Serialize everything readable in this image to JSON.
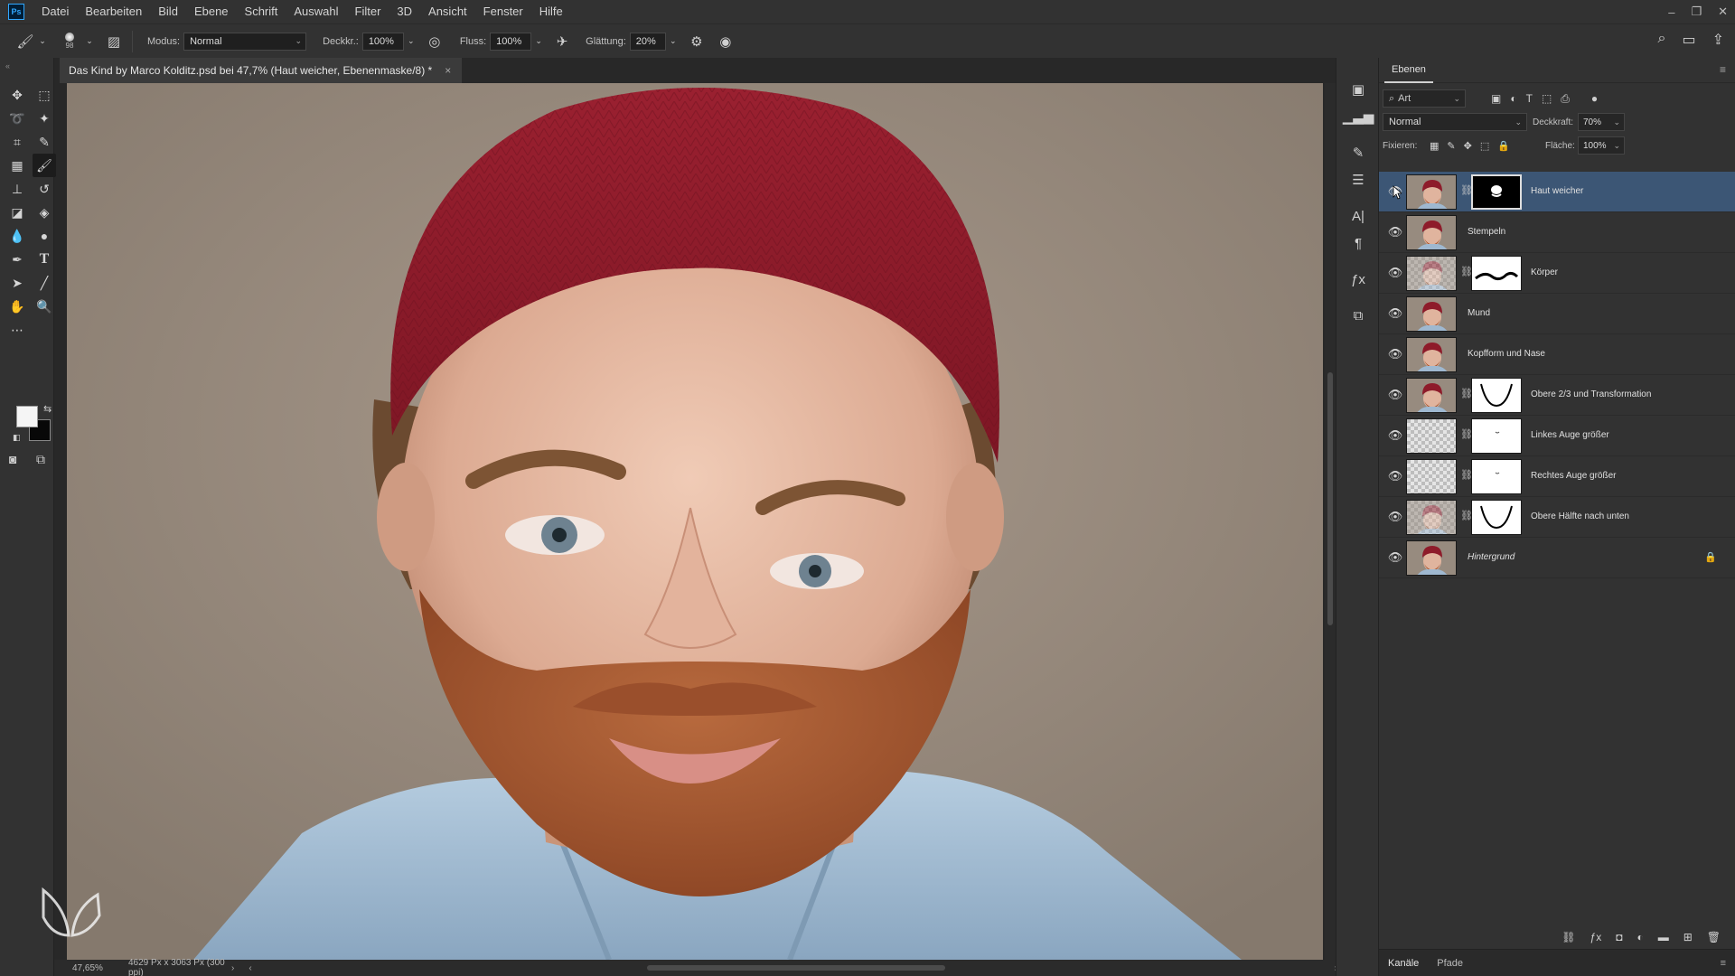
{
  "app": {
    "logo": "Ps"
  },
  "menu": [
    "Datei",
    "Bearbeiten",
    "Bild",
    "Ebene",
    "Schrift",
    "Auswahl",
    "Filter",
    "3D",
    "Ansicht",
    "Fenster",
    "Hilfe"
  ],
  "options": {
    "brush_size": "98",
    "mode_label": "Modus:",
    "mode_value": "Normal",
    "opacity_label": "Deckkr.:",
    "opacity_value": "100%",
    "flow_label": "Fluss:",
    "flow_value": "100%",
    "smoothing_label": "Glättung:",
    "smoothing_value": "20%"
  },
  "document": {
    "tab_title": "Das Kind by Marco Kolditz.psd bei 47,7% (Haut weicher, Ebenenmaske/8) *",
    "close_glyph": "×"
  },
  "status": {
    "zoom": "47,65%",
    "dimensions": "4629 Px x 3063 Px (300 ppi)"
  },
  "layers_panel": {
    "tab": "Ebenen",
    "filter_kind": "Art",
    "blend_mode": "Normal",
    "opacity_label": "Deckkraft:",
    "opacity_value": "70%",
    "lock_label": "Fixieren:",
    "fill_label": "Fläche:",
    "fill_value": "100%",
    "layers": [
      {
        "name": "Haut weicher",
        "has_mask": true,
        "selected": true,
        "thumb": "face",
        "mask": "dark"
      },
      {
        "name": "Stempeln",
        "has_mask": false,
        "thumb": "face"
      },
      {
        "name": "Körper",
        "has_mask": true,
        "thumb": "checker-face",
        "mask": "curve"
      },
      {
        "name": "Mund",
        "has_mask": false,
        "thumb": "face"
      },
      {
        "name": "Kopfform und Nase",
        "has_mask": false,
        "thumb": "face"
      },
      {
        "name": "Obere 2/3 und Transformation",
        "has_mask": true,
        "thumb": "face",
        "mask": "vcurve"
      },
      {
        "name": "Linkes Auge größer",
        "has_mask": true,
        "thumb": "checker",
        "mask": "dot"
      },
      {
        "name": "Rechtes Auge größer",
        "has_mask": true,
        "thumb": "checker",
        "mask": "dot"
      },
      {
        "name": "Obere Hälfte nach unten",
        "has_mask": true,
        "thumb": "checker-face",
        "mask": "vcurve"
      },
      {
        "name": "Hintergrund",
        "has_mask": false,
        "thumb": "face",
        "locked": true,
        "italic": true
      }
    ],
    "bottom_tabs": [
      "Kanäle",
      "Pfade"
    ]
  },
  "colors": {
    "selected_layer": "#3c5675",
    "beanie": "#8e1b2a",
    "skin": "#e0b49e",
    "beard": "#a5532c",
    "shirt": "#9fb8d0",
    "background": "#9b8d7f"
  }
}
